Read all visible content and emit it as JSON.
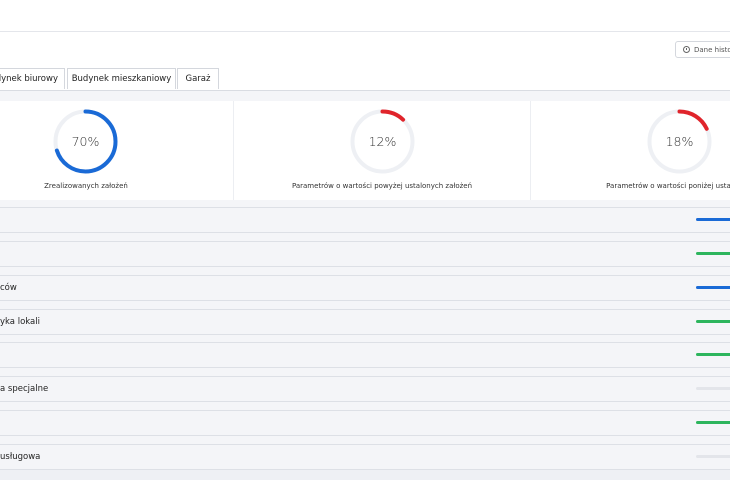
{
  "colors": {
    "blue": "#1a6ad6",
    "red": "#e0242b",
    "green": "#2db55d",
    "gray": "#e3e5ea",
    "track": "#eef0f4"
  },
  "toolbar": {
    "history_label": "Dane histo",
    "history_icon": "history-clock-icon"
  },
  "tabs": [
    {
      "label": "dynek biurowy"
    },
    {
      "label": "Budynek mieszkaniowy"
    },
    {
      "label": "Garaż"
    }
  ],
  "stats": [
    {
      "percent": 70,
      "percent_text": "70%",
      "label": "Zrealizowanych założeń",
      "color": "blue"
    },
    {
      "percent": 12,
      "percent_text": "12%",
      "label": "Parametrów o wartości powyżej ustalonych założeń",
      "color": "red"
    },
    {
      "percent": 18,
      "percent_text": "18%",
      "label": "Parametrów o wartości poniżej ustalonych",
      "color": "red"
    }
  ],
  "rows": [
    {
      "label": "",
      "bar": "blue"
    },
    {
      "label": "",
      "bar": "green"
    },
    {
      "label": "ców",
      "bar": "blue"
    },
    {
      "label": "yka lokali",
      "bar": "green"
    },
    {
      "label": "",
      "bar": "green"
    },
    {
      "label": "a specjalne",
      "bar": "gray"
    },
    {
      "label": "",
      "bar": "green"
    },
    {
      "label": "usługowa",
      "bar": "gray"
    }
  ]
}
